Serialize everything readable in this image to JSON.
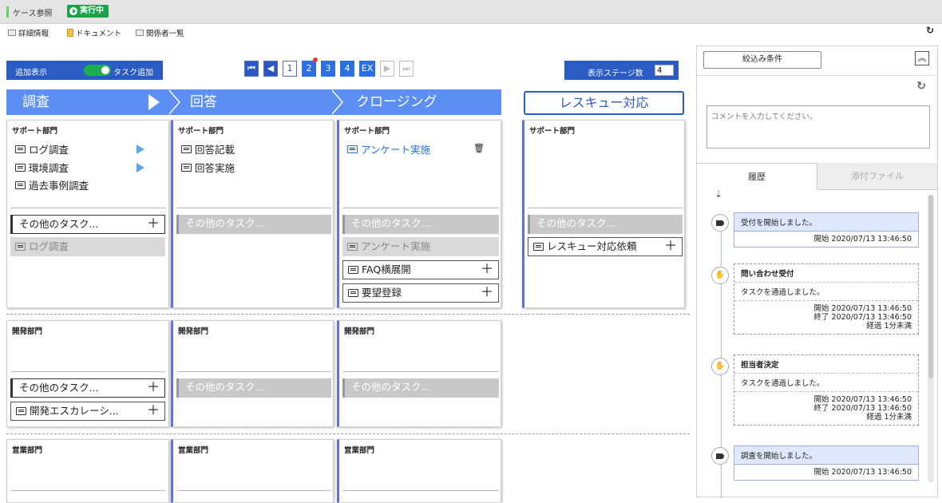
{
  "window": {
    "title": "ケース参照",
    "status_badge": "実行中"
  },
  "toolbar": {
    "details": "詳細情報",
    "documents": "ドキュメント",
    "stakeholders": "関係者一覧"
  },
  "controls": {
    "add_display_label": "追加表示",
    "toggle_label": "タスク追加",
    "toggle_on": true,
    "pager": [
      "1",
      "2",
      "3",
      "4",
      "EX"
    ],
    "pager_active": "2",
    "stage_count_label": "表示ステージ数",
    "stage_count_value": "4"
  },
  "stages": [
    "調査",
    "回答",
    "クロージング",
    "レスキュー対応"
  ],
  "rows": [
    {
      "dept": "サポート部門",
      "columns": [
        {
          "tasks": [
            "ログ調査",
            "環境調査",
            "過去事例調査"
          ],
          "other": "その他のタスク...",
          "extra": [
            "ログ調査"
          ]
        },
        {
          "tasks": [
            "回答記載",
            "回答実施"
          ],
          "other": "その他のタスク..."
        },
        {
          "tasks": [
            "アンケート実施"
          ],
          "other": "その他のタスク...",
          "extra": [
            "アンケート実施",
            "FAQ横展開",
            "要望登録"
          ]
        },
        {
          "tasks": [],
          "other": "その他のタスク...",
          "extra": [
            "レスキュー対応依頼"
          ]
        }
      ]
    },
    {
      "dept": "開発部門",
      "columns": [
        {
          "other": "その他のタスク...",
          "extra": [
            "開発エスカレーシ..."
          ]
        },
        {
          "other": "その他のタスク..."
        },
        {
          "other": "その他のタスク..."
        }
      ]
    },
    {
      "dept": "営業部門"
    }
  ],
  "panel": {
    "filter_button": "絞込み条件",
    "comment_placeholder": "コメントを入力してください。",
    "tab_history": "履歴",
    "tab_attachments": "添付ファイル",
    "history": [
      {
        "title": "受付を開始しました。",
        "meta": [
          "開始 2020/07/13 13:46:50"
        ]
      },
      {
        "title": "問い合わせ受付",
        "body": "タスクを通過しました。",
        "meta": [
          "開始 2020/07/13 13:46:50",
          "終了 2020/07/13 13:46:50",
          "経過 1分未満"
        ]
      },
      {
        "title": "担当者決定",
        "body": "タスクを通過しました。",
        "meta": [
          "開始 2020/07/13 13:46:50",
          "終了 2020/07/13 13:46:50",
          "経過 1分未満"
        ]
      },
      {
        "title": "調査を開始しました。",
        "meta": [
          "開始 2020/07/13 13:46:50"
        ]
      }
    ]
  }
}
